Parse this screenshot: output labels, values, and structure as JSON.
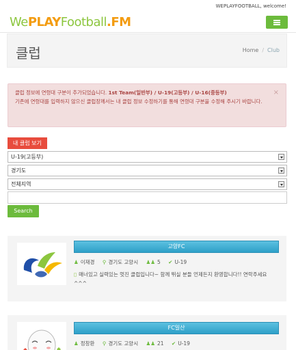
{
  "header": {
    "welcome": "WEPLAYFOOTBALL, welcome!",
    "logo": {
      "part1": "We",
      "part2": "PLAY",
      "part3": "Football",
      "part4": ".FM"
    }
  },
  "page": {
    "title": "클럽",
    "breadcrumb": {
      "home": "Home",
      "separator": "/",
      "current": "Club"
    }
  },
  "alert": {
    "line1_prefix": "클럽 정보에 연령대 구분이 추가되었습니다.",
    "line1_strong": "1st Team(일반부) / U-19(고등부) / U-16(중등부)",
    "line2": "기존에 연령대를 입력하지 않으신 클럽장께서는 내 클럽 정보 수정하기를 통해 연령대 구분을 수정해 주시기 바랍니다.",
    "close": "×"
  },
  "filter": {
    "view_my_club": "내 클럽 보기",
    "age_select": "U-19(고등부)",
    "province_select": "경기도",
    "region_select": "전체지역",
    "search_label": "Search"
  },
  "clubs": [
    {
      "name": "고양FC",
      "leader": "이재경",
      "location": "경기도 고양시",
      "members": "5",
      "age": "U-19",
      "description": "매너있고 실력있는 멋진 클럽입니다~ 함께 뛰실 분들 언제든지 환영합니다!! 연락주세요 ^^^"
    },
    {
      "name": "FC일산",
      "leader": "정창환",
      "location": "경기도 고양시",
      "members": "21",
      "age": "U-19",
      "description": ""
    }
  ],
  "colors": {
    "brand_green": "#6cbb3c",
    "brand_orange": "#f39c12",
    "alert_bg": "#f2dede",
    "alert_text": "#a94442",
    "club_header_blue": "#2ea0c8",
    "view_label_red": "#e84c3d"
  }
}
